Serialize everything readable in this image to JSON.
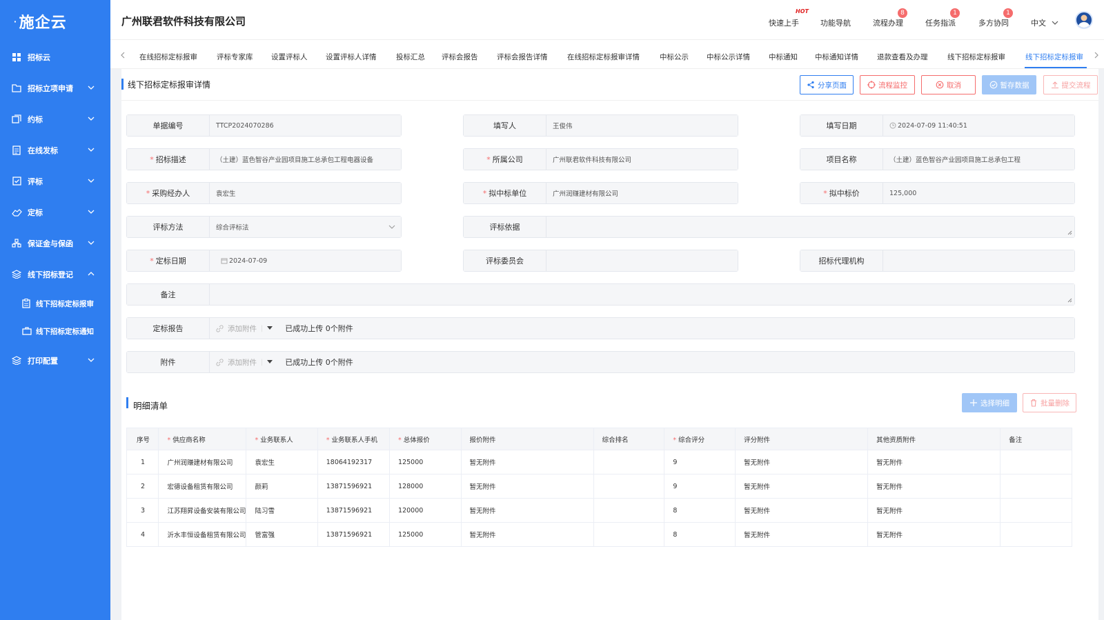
{
  "app": {
    "logo": "施企云"
  },
  "sidebar": {
    "items": [
      {
        "label": "招标云",
        "icon": "grid-icon"
      },
      {
        "label": "招标立项申请",
        "icon": "folder-icon"
      },
      {
        "label": "约标",
        "icon": "money-icon"
      },
      {
        "label": "在线发标",
        "icon": "document-icon"
      },
      {
        "label": "评标",
        "icon": "checklist-icon"
      },
      {
        "label": "定标",
        "icon": "handshake-icon"
      },
      {
        "label": "保证金与保函",
        "icon": "org-icon"
      },
      {
        "label": "线下招标登记",
        "icon": "layers-icon"
      }
    ],
    "subitems": [
      {
        "label": "线下招标定标报审",
        "icon": "clipboard-icon"
      },
      {
        "label": "线下招标定标通知",
        "icon": "bag-icon"
      }
    ],
    "last": {
      "label": "打印配置",
      "icon": "layers-icon"
    }
  },
  "topbar": {
    "company": "广州联君软件科技有限公司",
    "nav": [
      {
        "label": "快速上手",
        "badge": "HOT"
      },
      {
        "label": "功能导航",
        "badge": ""
      },
      {
        "label": "流程办理",
        "badge": "8"
      },
      {
        "label": "任务指派",
        "badge": "1"
      },
      {
        "label": "多方协同",
        "badge": "1"
      }
    ],
    "language": "中文"
  },
  "tabs": [
    "在线招标定标报审",
    "评标专家库",
    "设置评标人",
    "设置评标人详情",
    "投标汇总",
    "评标会报告",
    "评标会报告详情",
    "在线招标定标报审详情",
    "中标公示",
    "中标公示详情",
    "中标通知",
    "中标通知详情",
    "退款查看及办理",
    "线下招标定标报审",
    "线下招标定标报审"
  ],
  "page": {
    "title": "线下招标定标报审详情",
    "buttons": {
      "share": "分享页面",
      "monitor": "流程监控",
      "cancel": "取消",
      "save": "暂存数据",
      "submit": "提交流程"
    }
  },
  "form": {
    "doc_no": {
      "label": "单据编号",
      "value": "TTCP2024070286"
    },
    "writer": {
      "label": "填写人",
      "value": "王俊伟"
    },
    "fill_date": {
      "label": "填写日期",
      "value": "2024-07-09 11:40:51"
    },
    "desc": {
      "label": "招标描述",
      "value": "（土建）蓝色智谷产业园项目施工总承包工程电器设备"
    },
    "company": {
      "label": "所属公司",
      "value": "广州联君软件科技有限公司"
    },
    "project": {
      "label": "项目名称",
      "value": "（土建）蓝色智谷产业园项目施工总承包工程"
    },
    "buyer": {
      "label": "采购经办人",
      "value": "袁宏生"
    },
    "winner": {
      "label": "拟中标单位",
      "value": "广州润赚建材有限公司"
    },
    "price": {
      "label": "拟中标价",
      "value": "125,000"
    },
    "method": {
      "label": "评标方法",
      "value": "综合评标法"
    },
    "basis": {
      "label": "评标依据",
      "value": ""
    },
    "date": {
      "label": "定标日期",
      "value": "2024-07-09"
    },
    "committee": {
      "label": "评标委员会",
      "value": ""
    },
    "agency": {
      "label": "招标代理机构",
      "value": ""
    },
    "remark": {
      "label": "备注",
      "value": ""
    },
    "report": {
      "label": "定标报告",
      "add": "添加附件",
      "status": "已成功上传 0个附件"
    },
    "attach": {
      "label": "附件",
      "add": "添加附件",
      "status": "已成功上传 0个附件"
    }
  },
  "detail": {
    "title": "明细清单",
    "select_btn": "选择明细",
    "delete_btn": "批量删除",
    "headers": [
      "序号",
      "供应商名称",
      "业务联系人",
      "业务联系人手机",
      "总体报价",
      "报价附件",
      "综合排名",
      "综合评分",
      "评分附件",
      "其他资质附件",
      "备注"
    ],
    "rows": [
      [
        "1",
        "广州润赚建材有限公司",
        "袁宏生",
        "18064192317",
        "125000",
        "暂无附件",
        "",
        "9",
        "暂无附件",
        "暂无附件",
        ""
      ],
      [
        "2",
        "宏德设备租赁有限公司",
        "颜莉",
        "13871596921",
        "128000",
        "暂无附件",
        "",
        "9",
        "暂无附件",
        "暂无附件",
        ""
      ],
      [
        "3",
        "江苏翔昇设备安装有限公司",
        "陆习雪",
        "13871596921",
        "120000",
        "暂无附件",
        "",
        "8",
        "暂无附件",
        "暂无附件",
        ""
      ],
      [
        "4",
        "沂水丰恒设备租赁有限公司",
        "管富强",
        "13871596921",
        "125000",
        "暂无附件",
        "",
        "8",
        "暂无附件",
        "暂无附件",
        ""
      ]
    ]
  },
  "colors": {
    "primary": "#2f7ef0",
    "danger": "#f56c6c",
    "disabled": "#a0c6f7"
  }
}
